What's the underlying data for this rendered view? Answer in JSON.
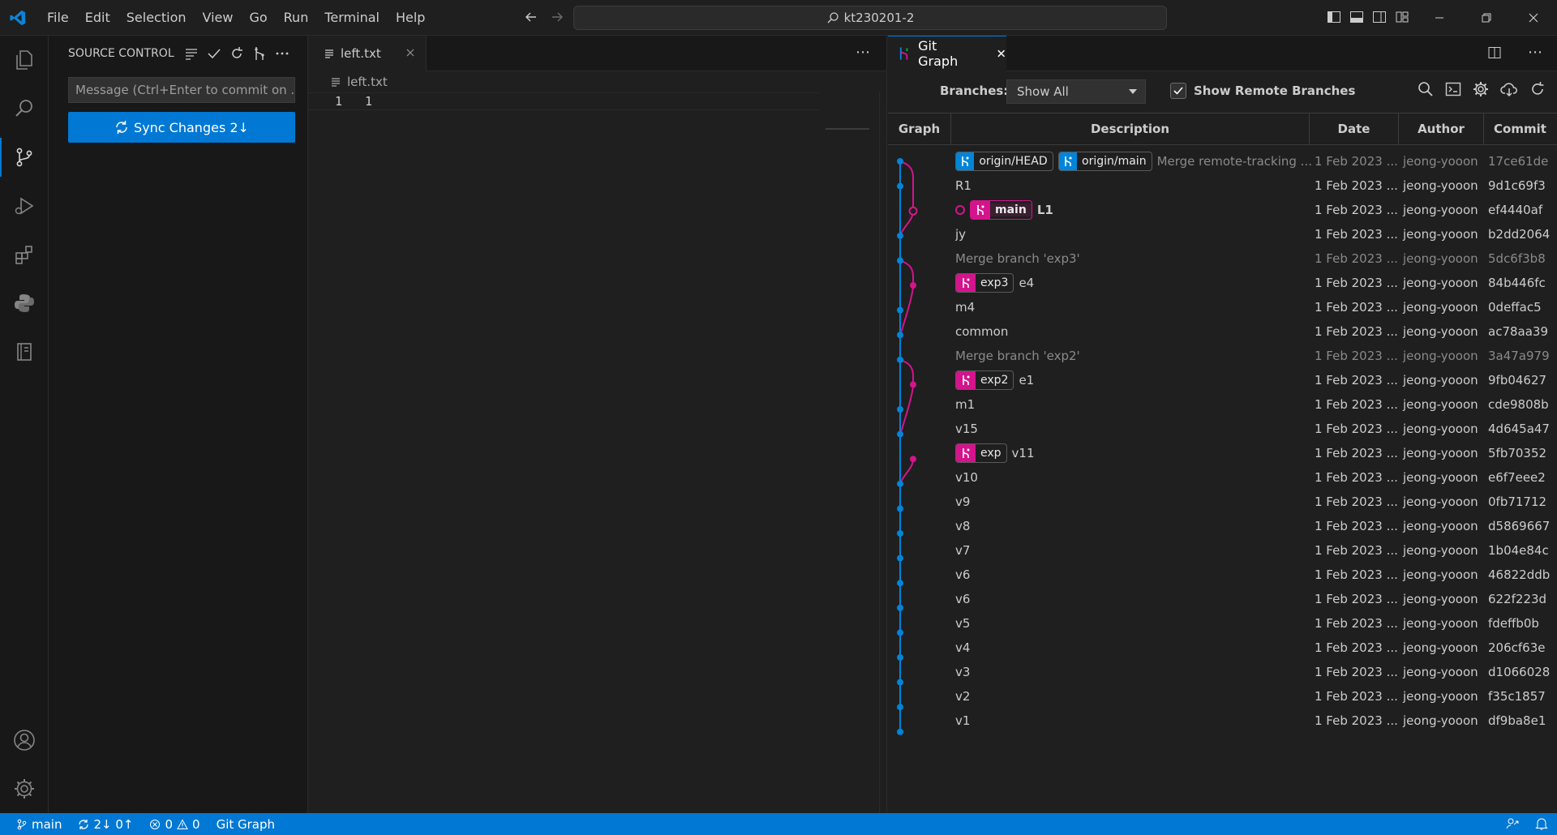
{
  "menu": [
    "File",
    "Edit",
    "Selection",
    "View",
    "Go",
    "Run",
    "Terminal",
    "Help"
  ],
  "command_center": "kt230201-2",
  "sidebar": {
    "title": "SOURCE CONTROL",
    "commit_placeholder": "Message (Ctrl+Enter to commit on ...",
    "sync_label": "Sync Changes 2↓"
  },
  "editor": {
    "tab_label": "left.txt",
    "breadcrumb": "left.txt",
    "line_number": "1",
    "line_content": "1"
  },
  "gitgraph": {
    "tab_label": "Git Graph",
    "branches_label": "Branches:",
    "branches_value": "Show All",
    "show_remote_label": "Show Remote Branches",
    "columns": [
      "Graph",
      "Description",
      "Date",
      "Author",
      "Commit"
    ],
    "commits": [
      {
        "refs": [
          {
            "name": "origin/HEAD",
            "kind": "blue"
          },
          {
            "name": "origin/main",
            "kind": "blue"
          }
        ],
        "message": "Merge remote-tracking ...",
        "dim": true,
        "date": "1 Feb 2023 ...",
        "author": "jeong-yooon",
        "hash": "17ce61de"
      },
      {
        "refs": [],
        "message": "R1",
        "dim": false,
        "date": "1 Feb 2023 ...",
        "author": "jeong-yooon",
        "hash": "9d1c69f3"
      },
      {
        "refs": [
          {
            "name": "main",
            "kind": "pink",
            "active": true
          }
        ],
        "current": true,
        "message": "L1",
        "bold": true,
        "dim": false,
        "date": "1 Feb 2023 ...",
        "author": "jeong-yooon",
        "hash": "ef4440af"
      },
      {
        "refs": [],
        "message": "jy",
        "dim": false,
        "date": "1 Feb 2023 ...",
        "author": "jeong-yooon",
        "hash": "b2dd2064"
      },
      {
        "refs": [],
        "message": "Merge branch 'exp3'",
        "dim": true,
        "date": "1 Feb 2023 ...",
        "author": "jeong-yooon",
        "hash": "5dc6f3b8"
      },
      {
        "refs": [
          {
            "name": "exp3",
            "kind": "pink"
          }
        ],
        "message": "e4",
        "dim": false,
        "date": "1 Feb 2023 ...",
        "author": "jeong-yooon",
        "hash": "84b446fc"
      },
      {
        "refs": [],
        "message": "m4",
        "dim": false,
        "date": "1 Feb 2023 ...",
        "author": "jeong-yooon",
        "hash": "0deffac5"
      },
      {
        "refs": [],
        "message": "common",
        "dim": false,
        "date": "1 Feb 2023 ...",
        "author": "jeong-yooon",
        "hash": "ac78aa39"
      },
      {
        "refs": [],
        "message": "Merge branch 'exp2'",
        "dim": true,
        "date": "1 Feb 2023 ...",
        "author": "jeong-yooon",
        "hash": "3a47a979"
      },
      {
        "refs": [
          {
            "name": "exp2",
            "kind": "pink"
          }
        ],
        "message": "e1",
        "dim": false,
        "date": "1 Feb 2023 ...",
        "author": "jeong-yooon",
        "hash": "9fb04627"
      },
      {
        "refs": [],
        "message": "m1",
        "dim": false,
        "date": "1 Feb 2023 ...",
        "author": "jeong-yooon",
        "hash": "cde9808b"
      },
      {
        "refs": [],
        "message": "v15",
        "dim": false,
        "date": "1 Feb 2023 ...",
        "author": "jeong-yooon",
        "hash": "4d645a47"
      },
      {
        "refs": [
          {
            "name": "exp",
            "kind": "pink"
          }
        ],
        "message": "v11",
        "dim": false,
        "date": "1 Feb 2023 ...",
        "author": "jeong-yooon",
        "hash": "5fb70352"
      },
      {
        "refs": [],
        "message": "v10",
        "dim": false,
        "date": "1 Feb 2023 ...",
        "author": "jeong-yooon",
        "hash": "e6f7eee2"
      },
      {
        "refs": [],
        "message": "v9",
        "dim": false,
        "date": "1 Feb 2023 ...",
        "author": "jeong-yooon",
        "hash": "0fb71712"
      },
      {
        "refs": [],
        "message": "v8",
        "dim": false,
        "date": "1 Feb 2023 ...",
        "author": "jeong-yooon",
        "hash": "d5869667"
      },
      {
        "refs": [],
        "message": "v7",
        "dim": false,
        "date": "1 Feb 2023 ...",
        "author": "jeong-yooon",
        "hash": "1b04e84c"
      },
      {
        "refs": [],
        "message": "v6",
        "dim": false,
        "date": "1 Feb 2023 ...",
        "author": "jeong-yooon",
        "hash": "46822ddb"
      },
      {
        "refs": [],
        "message": "v6",
        "dim": false,
        "date": "1 Feb 2023 ...",
        "author": "jeong-yooon",
        "hash": "622f223d"
      },
      {
        "refs": [],
        "message": "v5",
        "dim": false,
        "date": "1 Feb 2023 ...",
        "author": "jeong-yooon",
        "hash": "fdeffb0b"
      },
      {
        "refs": [],
        "message": "v4",
        "dim": false,
        "date": "1 Feb 2023 ...",
        "author": "jeong-yooon",
        "hash": "206cf63e"
      },
      {
        "refs": [],
        "message": "v3",
        "dim": false,
        "date": "1 Feb 2023 ...",
        "author": "jeong-yooon",
        "hash": "d1066028"
      },
      {
        "refs": [],
        "message": "v2",
        "dim": false,
        "date": "1 Feb 2023 ...",
        "author": "jeong-yooon",
        "hash": "f35c1857"
      },
      {
        "refs": [],
        "message": "v1",
        "dim": false,
        "date": "1 Feb 2023 ...",
        "author": "jeong-yooon",
        "hash": "df9ba8e1"
      }
    ]
  },
  "statusbar": {
    "branch": "main",
    "sync": "2↓ 0↑",
    "errors": "0",
    "warnings": "0",
    "gitgraph": "Git Graph"
  },
  "colors": {
    "accent": "#0078d4",
    "branch_blue": "#0085d9",
    "branch_pink": "#d4148c"
  }
}
